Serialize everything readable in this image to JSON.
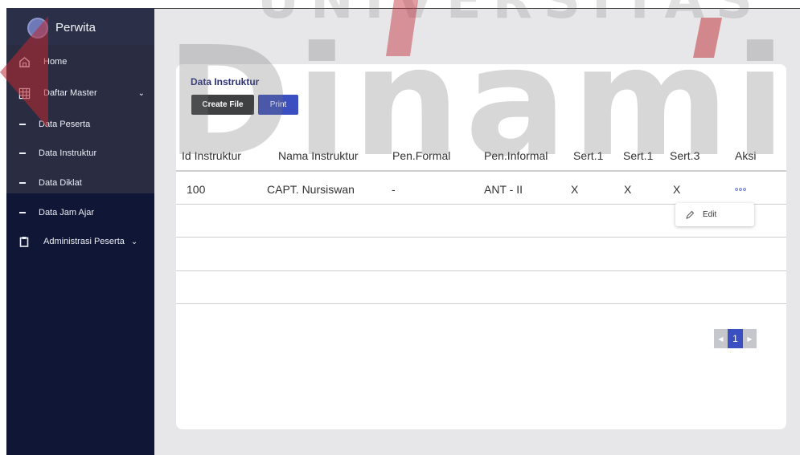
{
  "sidebar": {
    "brand": "Perwita",
    "items": [
      {
        "label": "Home",
        "icon": "home-icon"
      },
      {
        "label": "Daftar Master",
        "icon": "grid-icon",
        "chevron": "⌄"
      },
      {
        "label": "Data Peserta"
      },
      {
        "label": "Data Instruktur"
      },
      {
        "label": "Data Diklat"
      },
      {
        "label": "Data Jam Ajar"
      },
      {
        "label": "Administrasi Peserta",
        "icon": "clipboard-icon",
        "chevron": "⌄"
      }
    ]
  },
  "main": {
    "title": "Data Instruktur",
    "buttons": {
      "create": "Create File",
      "print": "Print"
    },
    "table": {
      "headers": [
        "Id Instruktur",
        "Nama Instruktur",
        "Pen.Formal",
        "Pen.Informal",
        "Sert.1",
        "Sert.1",
        "Sert.3",
        "Aksi"
      ],
      "rows": [
        [
          "100",
          "CAPT. Nursiswan",
          "-",
          "ANT - II",
          "X",
          "X",
          "X"
        ]
      ],
      "actions_icon": "more-dots-icon",
      "menu": {
        "edit": "Edit"
      }
    },
    "pagination": {
      "prev": "◀",
      "current": "1",
      "next": "▶"
    }
  },
  "watermark": {
    "top": "UNIVERSITAS",
    "main": "Dinamik"
  },
  "colors": {
    "sidebar": "#101635",
    "accent": "#3b4fc0",
    "title": "#2a2f7a"
  }
}
